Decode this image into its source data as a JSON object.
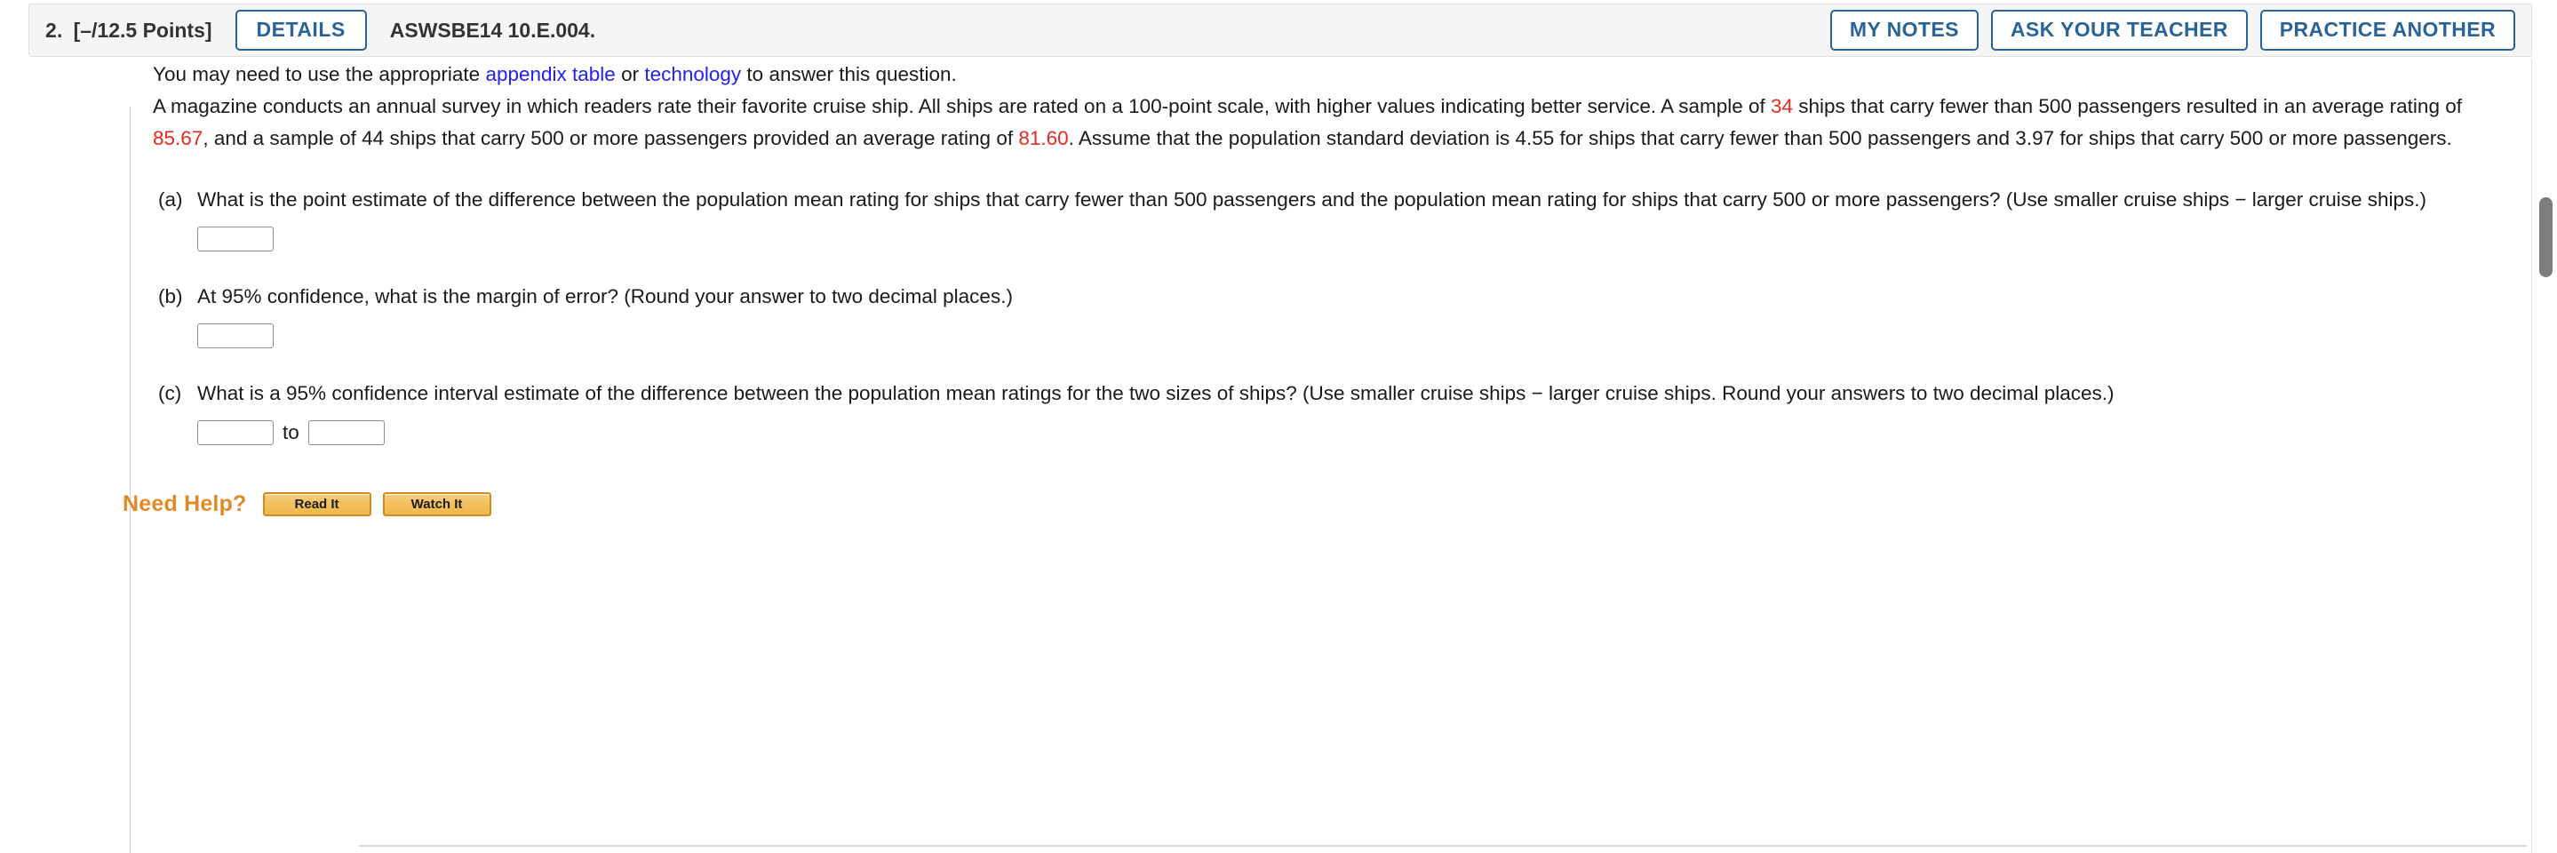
{
  "header": {
    "question_number": "2.",
    "points": "[–/12.5 Points]",
    "details_label": "DETAILS",
    "question_code": "ASWSBE14 10.E.004.",
    "my_notes_label": "MY NOTES",
    "ask_teacher_label": "ASK YOUR TEACHER",
    "practice_another_label": "PRACTICE ANOTHER",
    "accent_color": "#2a6496",
    "bar_background": "#f5f5f5"
  },
  "lead": {
    "prefix": "You may need to use the appropriate ",
    "link1": "appendix table",
    "middle": " or ",
    "link2": "technology",
    "suffix": " to answer this question.",
    "link_color": "#2222ee"
  },
  "problem": {
    "seg1": "A magazine conducts an annual survey in which readers rate their favorite cruise ship. All ships are rated on a 100-point scale, with higher values indicating better service. A sample of ",
    "val_sample1": "34",
    "seg2": " ships that carry fewer than 500 passengers resulted in an average rating of ",
    "val_mean1": "85.67",
    "seg3": ", and a sample of 44 ships that carry 500 or more passengers provided an average rating of ",
    "val_mean2": "81.60",
    "seg4": ". Assume that the population standard deviation is 4.55 for ships that carry fewer than 500 passengers and 3.97 for ships that carry 500 or more passengers.",
    "highlight_color": "#e8281e"
  },
  "parts": [
    {
      "label": "(a)",
      "text": "What is the point estimate of the difference between the population mean rating for ships that carry fewer than 500 passengers and the population mean rating for ships that carry 500 or more passengers? (Use smaller cruise ships − larger cruise ships.)",
      "answer_value": "",
      "answer_placeholder": ""
    },
    {
      "label": "(b)",
      "text": "At 95% confidence, what is the margin of error? (Round your answer to two decimal places.)",
      "answer_value": "",
      "answer_placeholder": ""
    },
    {
      "label": "(c)",
      "text": "What is a 95% confidence interval estimate of the difference between the population mean ratings for the two sizes of ships? (Use smaller cruise ships − larger cruise ships. Round your answers to two decimal places.)",
      "answer_value": "",
      "answer_placeholder": "",
      "answer_value_upper": "",
      "answer_placeholder_upper": "",
      "between_label": "to"
    }
  ],
  "need_help": {
    "label": "Need Help?",
    "read_it_label": "Read It",
    "watch_it_label": "Watch It",
    "label_color": "#e08a25"
  }
}
